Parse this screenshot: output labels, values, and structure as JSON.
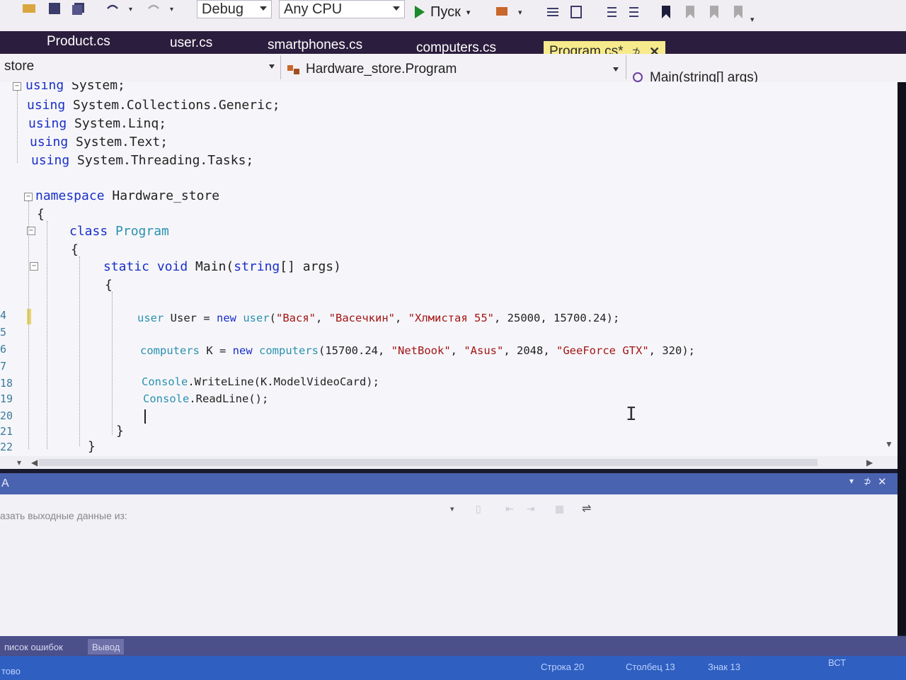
{
  "toolbar": {
    "config": "Debug",
    "platform": "Any CPU",
    "run_label": "Пуск"
  },
  "tabs": [
    {
      "label": "Product.cs"
    },
    {
      "label": "user.cs"
    },
    {
      "label": "smartphones.cs"
    },
    {
      "label": "computers.cs"
    },
    {
      "label": "Program.cs*",
      "pin": "⊅",
      "close": "✕"
    }
  ],
  "nav": {
    "project": "store",
    "class": "Hardware_store.Program",
    "member": "Main(string[] args)"
  },
  "code": {
    "line_numbers": [
      "4",
      "5",
      "6",
      "7",
      "18",
      "19",
      "20",
      "21",
      "22"
    ],
    "lines": [
      {
        "kw": "using",
        "rest": " System;"
      },
      {
        "kw": "using",
        "rest": " System.Collections.Generic;"
      },
      {
        "kw": "using",
        "rest": " System.Linq;"
      },
      {
        "kw": "using",
        "rest": " System.Text;"
      },
      {
        "kw": "using",
        "rest": " System.Threading.Tasks;"
      },
      {
        "kw": "namespace",
        "rest": " Hardware_store"
      },
      {
        "text": "{"
      },
      {
        "kw": "class",
        "ty": " Program"
      },
      {
        "text": "{"
      },
      {
        "kw": "static void",
        "a": " Main(",
        "ty": "string",
        "rest": "[] args)"
      },
      {
        "text": "{"
      },
      {
        "ty": "user",
        "a": " User = ",
        "kw": "new",
        "b": " ",
        "ty2": "user",
        "c": "(",
        "s1": "\"Вася\"",
        "d": ", ",
        "s2": "\"Васечкин\"",
        "e": ", ",
        "s3": "\"Хлмистая 55\"",
        "f": ", 25000, 15700.24);"
      },
      {
        "ty": "computers",
        "a": " K = ",
        "kw": "new",
        "b": " ",
        "ty2": "computers",
        "c": "(15700.24, ",
        "s1": "\"NetBook\"",
        "d": ", ",
        "s2": "\"Asus\"",
        "e": ", 2048, ",
        "s3": "\"GeeForce GTX\"",
        "f": ", 320);"
      },
      {
        "ty": "Console",
        "rest": ".WriteLine(K.ModelVideoCard);"
      },
      {
        "ty": "Console",
        "rest": ".ReadLine();"
      },
      {
        "text": "}"
      },
      {
        "text": "}"
      }
    ]
  },
  "panel": {
    "title": "А",
    "show_output_label": "азать выходные данные из:"
  },
  "bottom_tabs": [
    {
      "label": "писок ошибок"
    },
    {
      "label": "Вывод"
    }
  ],
  "status": {
    "left": "тово",
    "row": "Строка 20",
    "col": "Столбец 13",
    "char": "Знак 13",
    "mode": "ВСТ"
  }
}
